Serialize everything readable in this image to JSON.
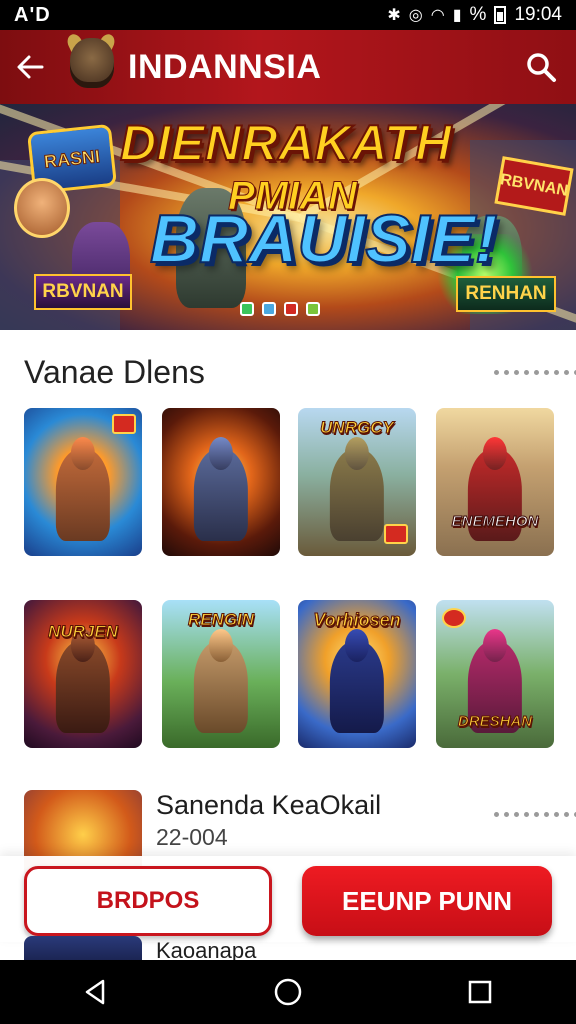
{
  "status_bar": {
    "left_text": "A'D",
    "time": "19:04",
    "battery_text": "%"
  },
  "app_bar": {
    "title": "INDANNSIA",
    "icons": [
      "back-arrow-icon",
      "mascot-icon",
      "search-icon"
    ]
  },
  "banner": {
    "title": "DIENRAKATH",
    "subtitle": "PMIAN",
    "main": "BRAUISIE!",
    "badge_left": "RASNI",
    "sign_left": "RBVNAN",
    "sign_right": "RENHAN",
    "plate_right": "RBVNAN"
  },
  "section": {
    "title": "Vanae Dlens"
  },
  "games": [
    {
      "label": "",
      "chip": true
    },
    {
      "label": "",
      "chip": false
    },
    {
      "label": "UNRGCY",
      "chip": true
    },
    {
      "label": "ENEMEHON",
      "chip": false
    },
    {
      "label": "NURJEN",
      "chip": false
    },
    {
      "label": "RENGIN",
      "chip": false
    },
    {
      "label": "Vorhiosen",
      "chip": false
    },
    {
      "label": "DRESHAN",
      "chip": true
    }
  ],
  "list": {
    "item1_title": "Sanenda KeaOkail",
    "item1_sub": "22-004",
    "item2_title": "Kaoanapa"
  },
  "actions": {
    "outline_label": "BRDPOS",
    "primary_label": "EEUNP PUNN"
  },
  "colors": {
    "brand_red": "#c9161e",
    "app_bar": "#a0141a"
  }
}
